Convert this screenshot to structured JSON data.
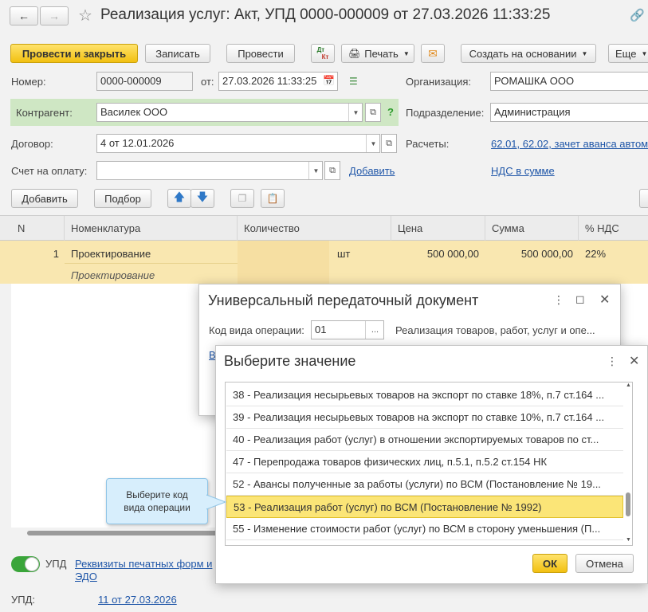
{
  "window": {
    "title": "Реализация услуг: Акт, УПД 0000-000009 от 27.03.2026 11:33:25"
  },
  "toolbar": {
    "post_close": "Провести и закрыть",
    "save": "Записать",
    "post": "Провести",
    "print": "Печать",
    "create_based": "Создать на основании",
    "more": "Еще",
    "dtkt_top": "Дт",
    "dtkt_bottom": "Кт"
  },
  "header": {
    "number_label": "Номер:",
    "number_value": "0000-000009",
    "date_label": "от:",
    "date_value": "27.03.2026 11:33:25",
    "org_label": "Организация:",
    "org_value": "РОМАШКА ООО",
    "contractor_label": "Контрагент:",
    "contractor_value": "Василек ООО",
    "help": "?",
    "division_label": "Подразделение:",
    "division_value": "Администрация",
    "contract_label": "Договор:",
    "contract_value": "4 от 12.01.2026",
    "settlements_label": "Расчеты:",
    "settlements_link": "62.01, 62.02, зачет аванса автом",
    "invoice_label": "Счет на оплату:",
    "invoice_value": "",
    "add_link": "Добавить",
    "vat_link": "НДС в сумме"
  },
  "table_toolbar": {
    "add": "Добавить",
    "pick": "Подбор"
  },
  "table": {
    "columns": [
      "N",
      "Номенклатура",
      "Количество",
      "Цена",
      "Сумма",
      "% НДС"
    ],
    "rows": [
      {
        "n": "1",
        "item": "Проектирование",
        "item_sub": "Проектирование",
        "unit": "шт",
        "price": "500 000,00",
        "sum": "500 000,00",
        "vat": "22%"
      }
    ]
  },
  "footer": {
    "upd_toggle_label": "УПД",
    "print_link_line1": "Реквизиты печатных форм и",
    "print_link_line2": "ЭДО",
    "upd_label": "УПД:",
    "upd_link": "11 от 27.03.2026"
  },
  "upd_dialog": {
    "title": "Универсальный передаточный документ",
    "op_code_label": "Код вида операции:",
    "op_code_value": "01",
    "op_code_desc": "Реализация товаров, работ, услуг и опе...",
    "partial_link": "В"
  },
  "select_dialog": {
    "title": "Выберите значение",
    "items": [
      "38 - Реализация несырьевых товаров на экспорт по ставке 18%, п.7 ст.164 ...",
      "39 - Реализация несырьевых товаров на экспорт по ставке 10%, п.7 ст.164 ...",
      "40 - Реализация работ (услуг) в отношении экспортируемых товаров по ст...",
      "47 - Перепродажа товаров физических лиц, п.5.1, п.5.2 ст.154 НК",
      "52 - Авансы полученные за работы (услуги) по ВСМ (Постановление № 19...",
      "53 - Реализация работ (услуг) по ВСМ (Постановление № 1992)",
      "55 - Изменение стоимости работ (услуг) по ВСМ в сторону уменьшения (П..."
    ],
    "selected_index": 5,
    "ok": "ОК",
    "cancel": "Отмена"
  },
  "callout": {
    "line1": "Выберите код",
    "line2": "вида операции"
  }
}
